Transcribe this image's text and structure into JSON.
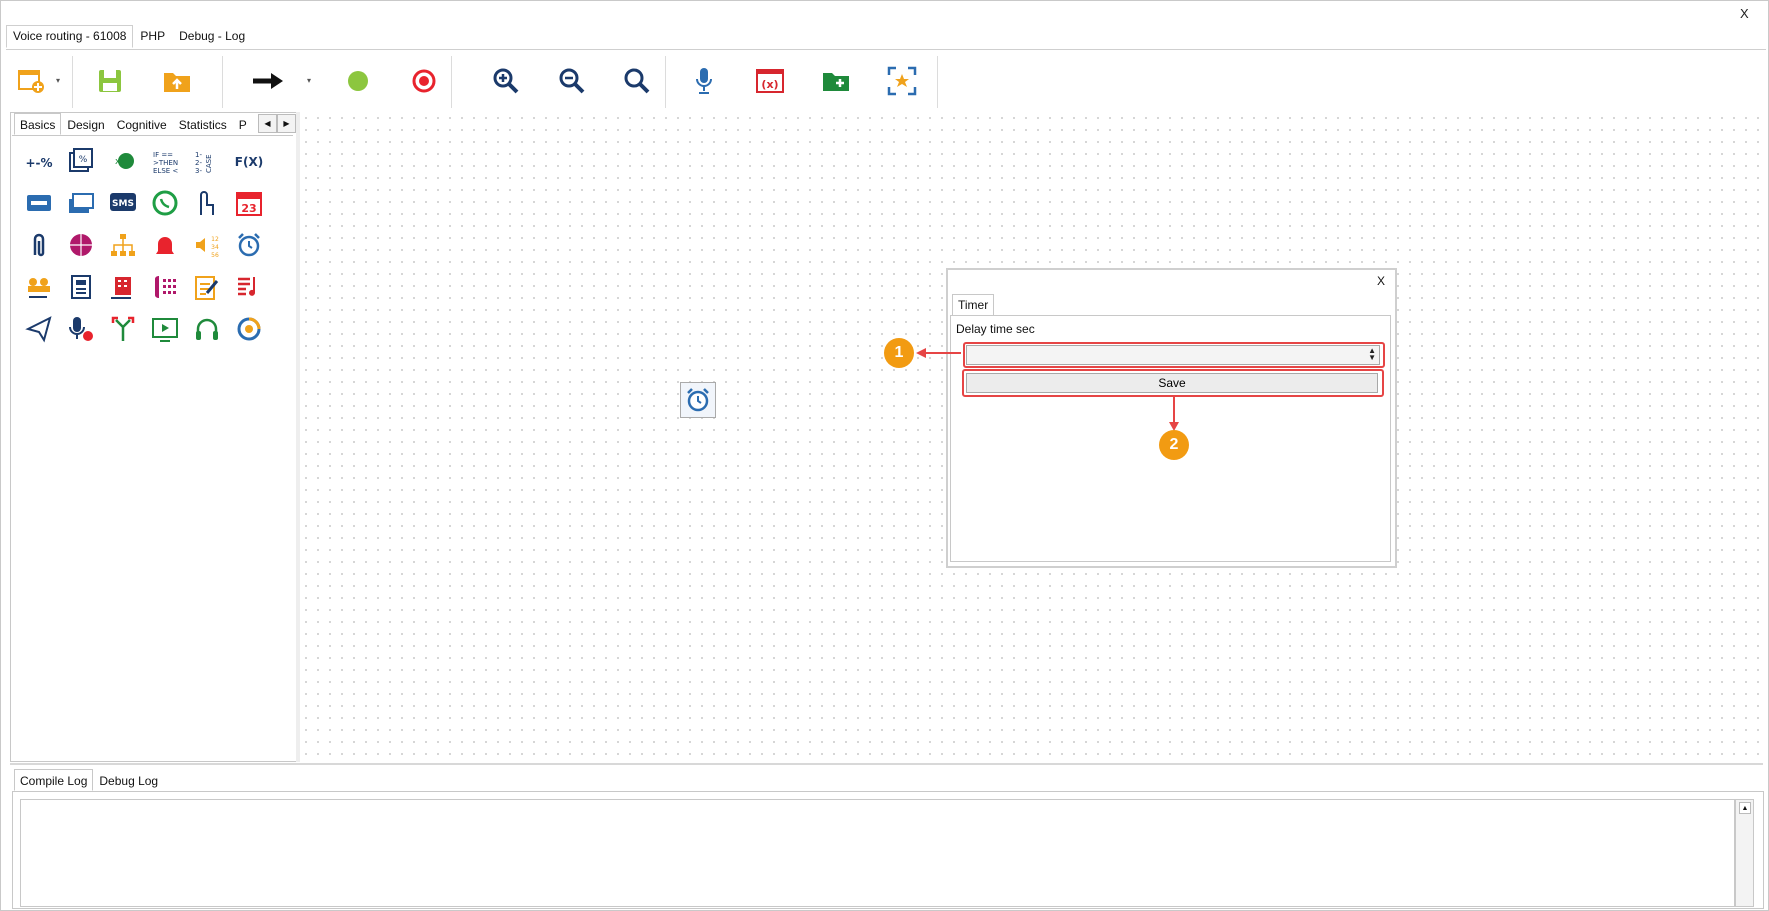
{
  "window": {
    "close_label": "X"
  },
  "tabs": [
    {
      "label": "Voice routing - 61008",
      "active": true
    },
    {
      "label": "PHP",
      "active": false
    },
    {
      "label": "Debug - Log",
      "active": false
    }
  ],
  "toolbar": {
    "buttons": [
      "new-flow-icon",
      "save-icon",
      "upload-icon",
      "arrow-connector-icon",
      "start-node-icon",
      "end-node-icon",
      "zoom-in-icon",
      "zoom-out-icon",
      "zoom-reset-icon",
      "microphone-icon",
      "variables-icon",
      "add-folder-icon",
      "fit-view-icon"
    ]
  },
  "palette": {
    "tabs": [
      "Basics",
      "Design",
      "Cognitive",
      "Statistics",
      "Pr"
    ],
    "active_tab": "Basics",
    "items": [
      {
        "icon": "math-operations-icon",
        "text": "+-%"
      },
      {
        "icon": "percent-stack-icon",
        "text": "%"
      },
      {
        "icon": "globe-variable-icon",
        "text": "x"
      },
      {
        "icon": "if-then-else-icon",
        "text": "IF"
      },
      {
        "icon": "case-list-icon",
        "text": "CASE"
      },
      {
        "icon": "function-icon",
        "text": "F(X)"
      },
      {
        "icon": "voicemail-icon",
        "text": ""
      },
      {
        "icon": "voicemail-stack-icon",
        "text": ""
      },
      {
        "icon": "sms-icon",
        "text": "SMS"
      },
      {
        "icon": "whatsapp-icon",
        "text": ""
      },
      {
        "icon": "dtmf-input-icon",
        "text": ""
      },
      {
        "icon": "calendar-icon",
        "text": "23"
      },
      {
        "icon": "attachment-icon",
        "text": ""
      },
      {
        "icon": "web-icon",
        "text": ""
      },
      {
        "icon": "hierarchy-icon",
        "text": ""
      },
      {
        "icon": "alarm-bell-icon",
        "text": ""
      },
      {
        "icon": "say-numbers-icon",
        "text": "12"
      },
      {
        "icon": "timer-icon",
        "text": ""
      },
      {
        "icon": "queue-agents-icon",
        "text": ""
      },
      {
        "icon": "phone-transfer-icon",
        "text": ""
      },
      {
        "icon": "company-transfer-icon",
        "text": ""
      },
      {
        "icon": "phone-keypad-icon",
        "text": ""
      },
      {
        "icon": "notes-icon",
        "text": ""
      },
      {
        "icon": "music-playlist-icon",
        "text": ""
      },
      {
        "icon": "send-icon",
        "text": ""
      },
      {
        "icon": "record-voice-icon",
        "text": ""
      },
      {
        "icon": "split-route-icon",
        "text": ""
      },
      {
        "icon": "video-play-icon",
        "text": ""
      },
      {
        "icon": "headset-icon",
        "text": ""
      },
      {
        "icon": "cycle-icon",
        "text": ""
      }
    ]
  },
  "canvas": {
    "node_icon": "timer-icon"
  },
  "dialog": {
    "close_label": "X",
    "tab_label": "Timer",
    "field_label": "Delay time sec",
    "field_value": "",
    "save_label": "Save"
  },
  "annotations": [
    {
      "number": "1"
    },
    {
      "number": "2"
    }
  ],
  "annotation_color": "#e64545",
  "marker_color": "#f29b12",
  "bottom": {
    "tabs": [
      "Compile Log",
      "Debug Log"
    ],
    "active_tab": "Compile Log",
    "log_text": ""
  }
}
